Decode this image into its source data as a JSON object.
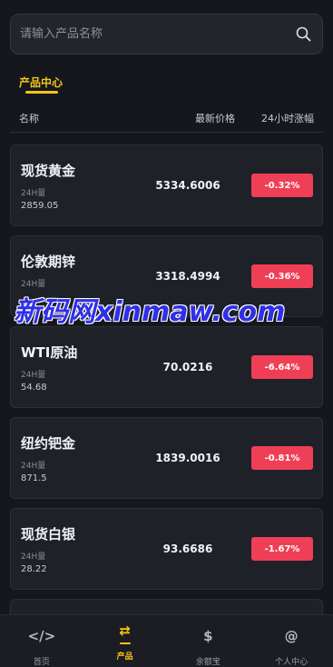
{
  "search": {
    "placeholder": "请输入产品名称",
    "icon": "search-icon"
  },
  "tab": {
    "label": "产品中心"
  },
  "columns": {
    "name": "名称",
    "price": "最新价格",
    "change": "24小时涨幅"
  },
  "colors": {
    "accent": "#f5c518",
    "negative": "#ef3f56",
    "background": "#15171d"
  },
  "products": [
    {
      "name": "现货黄金",
      "vol_label": "24H量",
      "vol": "2859.05",
      "price": "5334.6006",
      "change": "-0.32%"
    },
    {
      "name": "伦敦期锌",
      "vol_label": "24H量",
      "vol": "",
      "price": "3318.4994",
      "change": "-0.36%"
    },
    {
      "name": "WTI原油",
      "vol_label": "24H量",
      "vol": "54.68",
      "price": "70.0216",
      "change": "-6.64%"
    },
    {
      "name": "纽约钯金",
      "vol_label": "24H量",
      "vol": "871.5",
      "price": "1839.0016",
      "change": "-0.81%"
    },
    {
      "name": "现货白银",
      "vol_label": "24H量",
      "vol": "28.22",
      "price": "93.6686",
      "change": "-1.67%"
    }
  ],
  "watermark": "新码网xinmaw.com",
  "nav": [
    {
      "label": "首页",
      "icon": "code-icon",
      "glyph": "</>"
    },
    {
      "label": "产品",
      "icon": "swap-icon",
      "glyph": "⇄"
    },
    {
      "label": "余额宝",
      "icon": "dollar-icon",
      "glyph": "$"
    },
    {
      "label": "个人中心",
      "icon": "at-icon",
      "glyph": "@"
    }
  ]
}
